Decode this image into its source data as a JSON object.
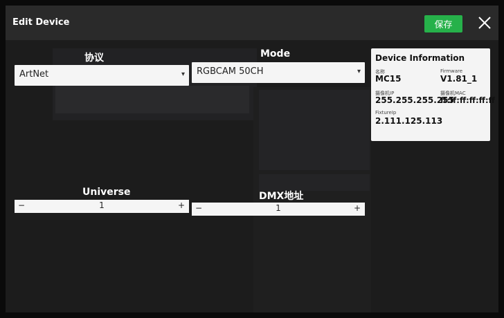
{
  "dialog": {
    "title": "Edit Device",
    "save_label": "保存",
    "colors": {
      "accent": "#26b14a",
      "titlebar": "#2a2a2a",
      "background": "#1c1c1c"
    }
  },
  "protocol": {
    "label": "协议",
    "value": "ArtNet"
  },
  "mode": {
    "label": "Mode",
    "value": "RGBCAM 50CH"
  },
  "universe": {
    "label": "Universe",
    "value": "1",
    "minus": "−",
    "plus": "+"
  },
  "dmx": {
    "label": "DMX地址",
    "value": "1",
    "minus": "−",
    "plus": "+"
  },
  "info": {
    "title": "Device Information",
    "name_label": "名称",
    "name_value": "MC15",
    "firmware_label": "Firmware",
    "firmware_value": "V1.81_1",
    "ip_label": "摄像机IP",
    "ip_value": "255.255.255.255",
    "mac_label": "摄像机MAC",
    "mac_value": "ff:ff:ff:ff:ff:ff",
    "fixtureip_label": "FixtureIp",
    "fixtureip_value": "2.111.125.113"
  }
}
